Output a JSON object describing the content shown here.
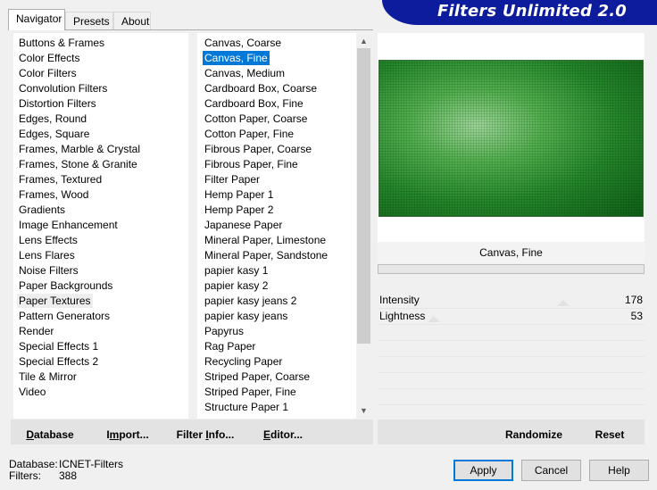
{
  "tabs": [
    "Navigator",
    "Presets",
    "About"
  ],
  "banner_title": "Filters Unlimited 2.0",
  "categories": [
    "Buttons & Frames",
    "Color Effects",
    "Color Filters",
    "Convolution Filters",
    "Distortion Filters",
    "Edges, Round",
    "Edges, Square",
    "Frames, Marble & Crystal",
    "Frames, Stone & Granite",
    "Frames, Textured",
    "Frames, Wood",
    "Gradients",
    "Image Enhancement",
    "Lens Effects",
    "Lens Flares",
    "Noise Filters",
    "Paper Backgrounds",
    "Paper Textures",
    "Pattern Generators",
    "Render",
    "Special Effects 1",
    "Special Effects 2",
    "Tile & Mirror",
    "Video"
  ],
  "selected_category": "Paper Textures",
  "filters": [
    "Canvas, Coarse",
    "Canvas, Fine",
    "Canvas, Medium",
    "Cardboard Box, Coarse",
    "Cardboard Box, Fine",
    "Cotton Paper, Coarse",
    "Cotton Paper, Fine",
    "Fibrous Paper, Coarse",
    "Fibrous Paper, Fine",
    "Filter Paper",
    "Hemp Paper 1",
    "Hemp Paper 2",
    "Japanese Paper",
    "Mineral Paper, Limestone",
    "Mineral Paper, Sandstone",
    "papier kasy 1",
    "papier kasy 2",
    "papier kasy jeans 2",
    "papier kasy jeans",
    "Papyrus",
    "Rag Paper",
    "Recycling Paper",
    "Striped Paper, Coarse",
    "Striped Paper, Fine",
    "Structure Paper 1"
  ],
  "selected_filter": "Canvas, Fine",
  "toolbar": {
    "database_u": "D",
    "database_rest": "atabase",
    "import_pre": "I",
    "import_u": "m",
    "import_rest": "port...",
    "filterinfo_pre": "Filter ",
    "filterinfo_u": "I",
    "filterinfo_rest": "nfo...",
    "editor_u": "E",
    "editor_rest": "ditor...",
    "randomize": "Randomize",
    "reset": "Reset"
  },
  "preview_filter_name": "Canvas, Fine",
  "params": [
    {
      "label": "Intensity",
      "value": "178"
    },
    {
      "label": "Lightness",
      "value": "53"
    }
  ],
  "status": {
    "database_label": "Database:",
    "database_value": "ICNET-Filters",
    "filters_label": "Filters:",
    "filters_value": "388"
  },
  "buttons": {
    "apply": "Apply",
    "cancel": "Cancel",
    "help": "Help"
  },
  "colors": {
    "banner": "#0c1c9c",
    "selection": "#0078d7",
    "preview_green": "#24872a"
  }
}
